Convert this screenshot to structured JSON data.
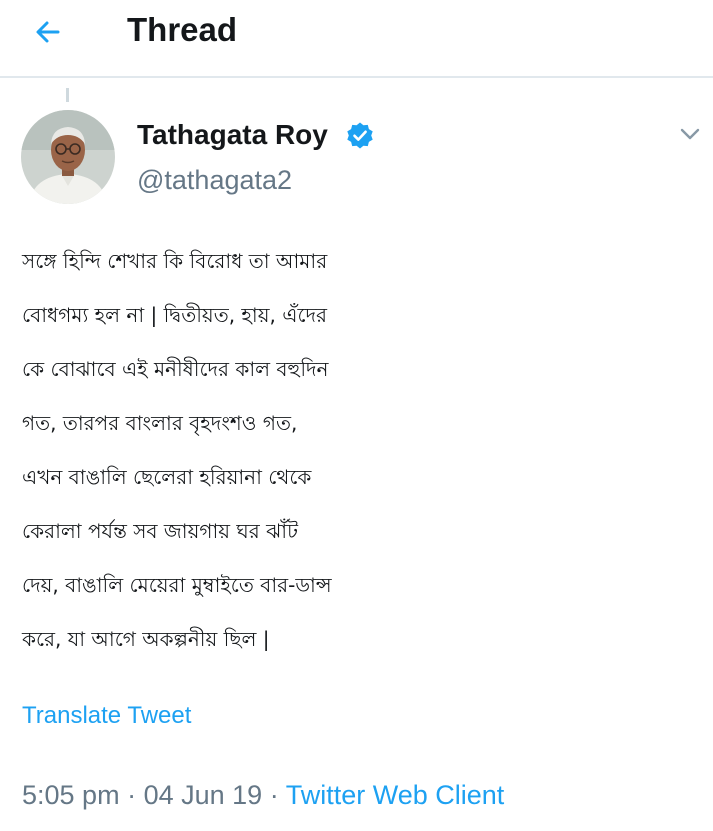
{
  "colors": {
    "accent": "#1da1f2",
    "text": "#14171a",
    "muted": "#657786",
    "divider": "#e1e8ed"
  },
  "header": {
    "back_icon": "back-arrow-icon",
    "title": "Thread"
  },
  "tweet": {
    "author": {
      "name": "Tathagata Roy",
      "handle": "@tathagata2",
      "verified_icon": "verified-badge-icon"
    },
    "menu_icon": "chevron-down-icon",
    "lines": [
      "সঙ্গে হিন্দি শেখার কি বিরোধ তা আমার",
      "বোধগম্য হল না | দ্বিতীয়ত, হায়, এঁদের",
      "কে বোঝাবে এই মনীষীদের কাল বহুদিন",
      "গত, তারপর বাংলার বৃহদংশও গত,",
      "এখন বাঙালি ছেলেরা হরিয়ানা থেকে",
      "কেরালা পর্যন্ত সব জায়গায় ঘর ঝাঁট",
      "দেয়, বাঙালি মেয়েরা মুম্বাইতে বার-ডান্স",
      "করে, যা আগে অকল্পনীয় ছিল |"
    ],
    "translate_label": "Translate Tweet",
    "time": "5:05 pm",
    "separator": "·",
    "date": "04 Jun 19",
    "client": "Twitter Web Client"
  }
}
